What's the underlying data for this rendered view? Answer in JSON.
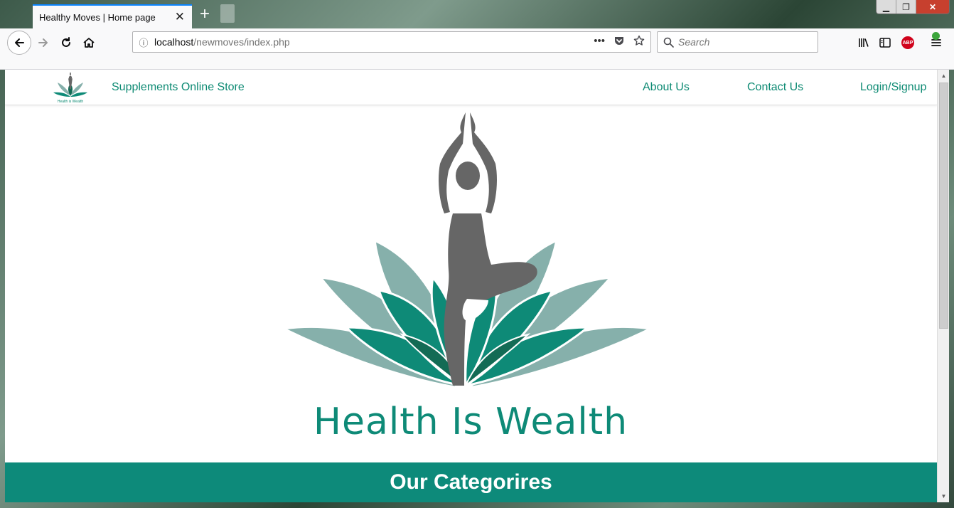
{
  "browser": {
    "tab_title": "Healthy Moves | Home page",
    "tab_close": "✕",
    "new_tab": "+",
    "url_host": "localhost",
    "url_path": "/newmoves/index.php",
    "search_placeholder": "Search",
    "window_minimize": "▁",
    "window_restore": "❐",
    "window_close": "✕",
    "abp_label": "ABP"
  },
  "site_nav": {
    "logo_caption": "Health is Wealth",
    "store_link": "Supplements Online Store",
    "about_link": "About Us",
    "contact_link": "Contact Us",
    "login_link": "Login/Signup"
  },
  "hero": {
    "tagline": "Health Is Wealth"
  },
  "categories": {
    "heading": "Our Categorires"
  },
  "colors": {
    "brand_teal": "#0d8a73",
    "banner_teal": "#0d8a7a",
    "petal_light": "#86b0ab",
    "petal_mid": "#0e8a77",
    "petal_dark": "#136b55",
    "figure_gray": "#666666"
  },
  "icons": {
    "back": "back-arrow-icon",
    "forward": "forward-arrow-icon",
    "reload": "reload-icon",
    "home": "home-icon",
    "page_info": "info-icon",
    "page_actions": "more-dots-icon",
    "pocket": "pocket-icon",
    "bookmark": "star-icon",
    "search": "search-icon",
    "library": "library-icon",
    "sidebar": "sidebar-icon",
    "adblock": "adblock-icon",
    "menu": "hamburger-menu-icon"
  }
}
